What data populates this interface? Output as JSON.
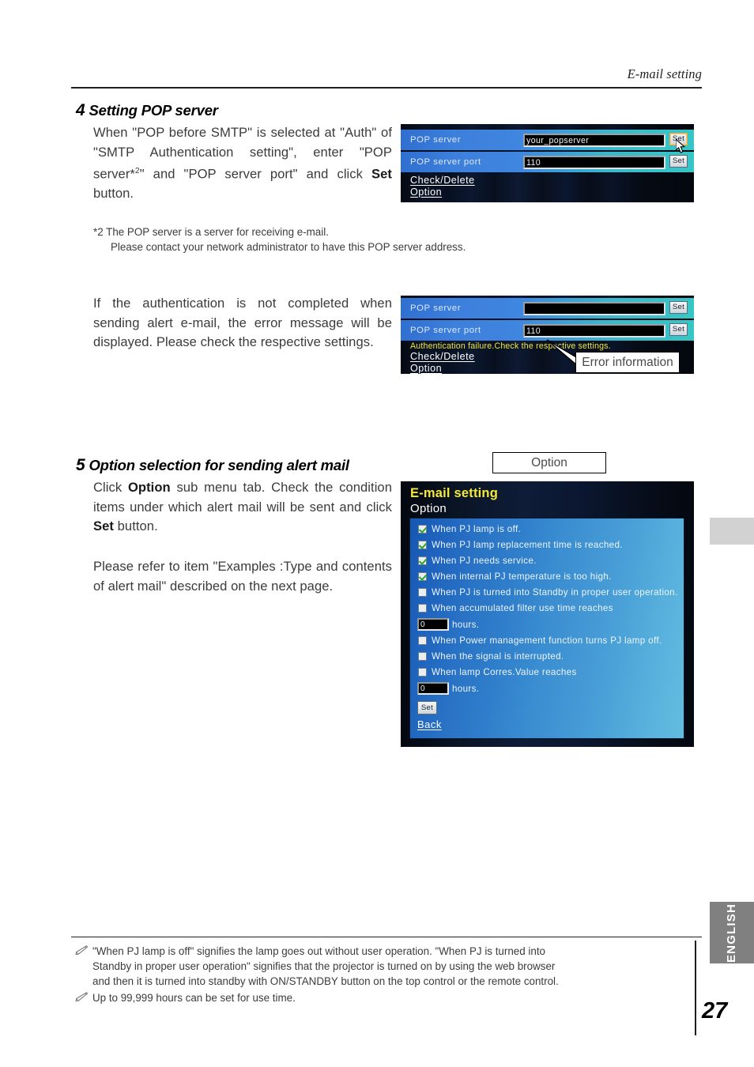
{
  "header": {
    "title": "E-mail setting"
  },
  "steps": [
    {
      "number": "4",
      "title": "Setting POP server",
      "body_html": "When \"POP before SMTP\" is selected at \"Auth\" of \"SMTP Authentication setting\", enter \"POP server*2\" and \"POP server port\" and click <b>Set</b> button."
    },
    {
      "number": "5",
      "title": "Option selection for sending alert mail",
      "body_html": "Click <b>Option</b> sub menu tab. Check the condition items under which alert mail will be sent and click <b>Set</b> button.",
      "body2_html": "Please refer to item \"Examples :Type and contents of alert mail\" described on the next page."
    }
  ],
  "footnote": {
    "marker": "*2",
    "line1": "*2 The POP server is a server for receiving e-mail.",
    "line2": "Please contact your network administrator to have this POP server address."
  },
  "error_paragraph": "If the authentication is not completed when sending alert e-mail, the error message will be displayed. Please check the respective settings.",
  "callouts": {
    "error_information": "Error information",
    "option": "Option"
  },
  "screenshot_pop": {
    "rows": [
      {
        "label": "POP server",
        "value": "your_popserver",
        "button": "Set"
      },
      {
        "label": "POP server port",
        "value": "110",
        "button": "Set"
      }
    ],
    "links": [
      "Check/Delete",
      "Option"
    ]
  },
  "screenshot_pop_error": {
    "rows": [
      {
        "label": "POP server",
        "value": "",
        "button": "Set"
      },
      {
        "label": "POP server port",
        "value": "110",
        "button": "Set"
      }
    ],
    "error_message": "Authentication failure.Check the respective settings.",
    "links": [
      "Check/Delete",
      "Option"
    ]
  },
  "screenshot_option": {
    "title": "E-mail setting",
    "subtitle": "Option",
    "items": [
      {
        "label": "When PJ lamp is off.",
        "checked": true
      },
      {
        "label": "When PJ lamp replacement time is reached.",
        "checked": true
      },
      {
        "label": "When PJ needs service.",
        "checked": true
      },
      {
        "label": "When internal PJ temperature is too high.",
        "checked": true
      },
      {
        "label": "When PJ is turned into Standby in proper user operation.",
        "checked": false
      },
      {
        "label": "When accumulated filter use time reaches",
        "checked": false
      }
    ],
    "filter_hours_value": "0",
    "filter_hours_label": "hours.",
    "items2": [
      {
        "label": "When Power management function turns PJ lamp off.",
        "checked": false
      },
      {
        "label": "When the signal is interrupted.",
        "checked": false
      },
      {
        "label": "When lamp Corres.Value reaches",
        "checked": false
      }
    ],
    "lamp_hours_value": "0",
    "lamp_hours_label": "hours.",
    "set_button": "Set",
    "back_link": "Back"
  },
  "notes": [
    {
      "line1": "\"When PJ lamp is off\" signifies the lamp goes out without user operation. \"When PJ is turned into",
      "line2": "Standby  in proper user operation\" signifies that the projector is turned on by using the web browser",
      "line3": "and then it is turned into standby with ON/STANDBY button on the top control or the remote control."
    },
    {
      "line1": "Up to 99,999 hours can be set for use time."
    }
  ],
  "sidebar": {
    "language_tab": "ENGLISH"
  },
  "page_number": "27",
  "colors": {
    "accent_yellow": "#f4e83a",
    "panel_blue": "#2f6fd0",
    "panel_cyan": "#37c6c6",
    "tab_gray": "#808080"
  }
}
